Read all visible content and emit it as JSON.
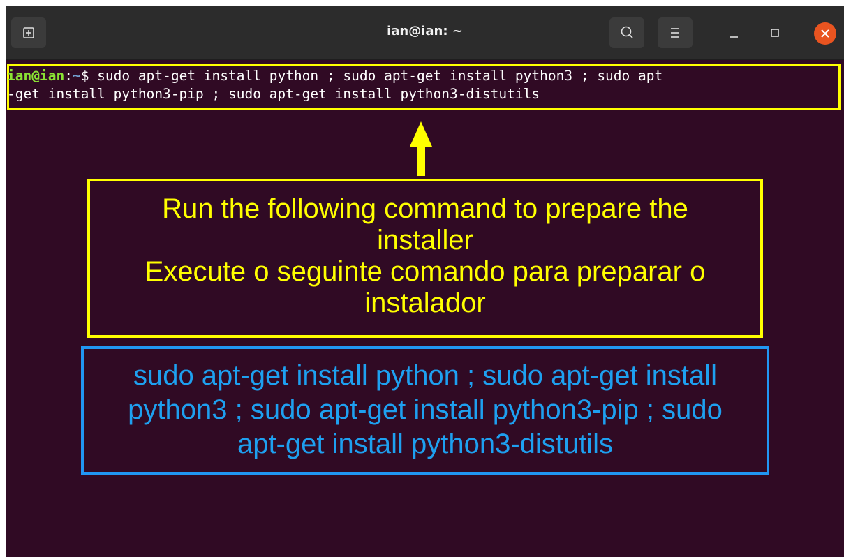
{
  "window": {
    "title": "ian@ian: ~"
  },
  "titlebar": {
    "new_tab_icon": "new-tab-icon",
    "search_icon": "search-icon",
    "menu_icon": "hamburger-menu-icon",
    "minimize_icon": "minimize-icon",
    "maximize_icon": "maximize-icon",
    "close_icon": "close-icon"
  },
  "terminal": {
    "prompt_user": "ian@ian",
    "prompt_sep": ":",
    "prompt_path": "~",
    "prompt_symbol": "$",
    "command_line_1": " sudo apt-get install python ; sudo apt-get install python3 ; sudo apt",
    "command_line_2": "-get install python3-pip ; sudo apt-get install python3-distutils"
  },
  "annotation": {
    "line_1": "Run the following command to prepare the",
    "line_2": "installer",
    "line_3": "Execute o seguinte comando para preparar o",
    "line_4": "instalador"
  },
  "code_callout": {
    "line_1": "sudo apt-get install python ; sudo apt-get install",
    "line_2": "python3 ; sudo apt-get install python3-pip ; sudo",
    "line_3": "apt-get install python3-distutils"
  },
  "colors": {
    "terminal_bg": "#300a24",
    "titlebar_bg": "#2c2c2c",
    "highlight_yellow": "#ffff00",
    "callout_blue": "#2196f3",
    "close_orange": "#e95420",
    "prompt_green": "#8ae234",
    "prompt_blue": "#729fcf"
  }
}
